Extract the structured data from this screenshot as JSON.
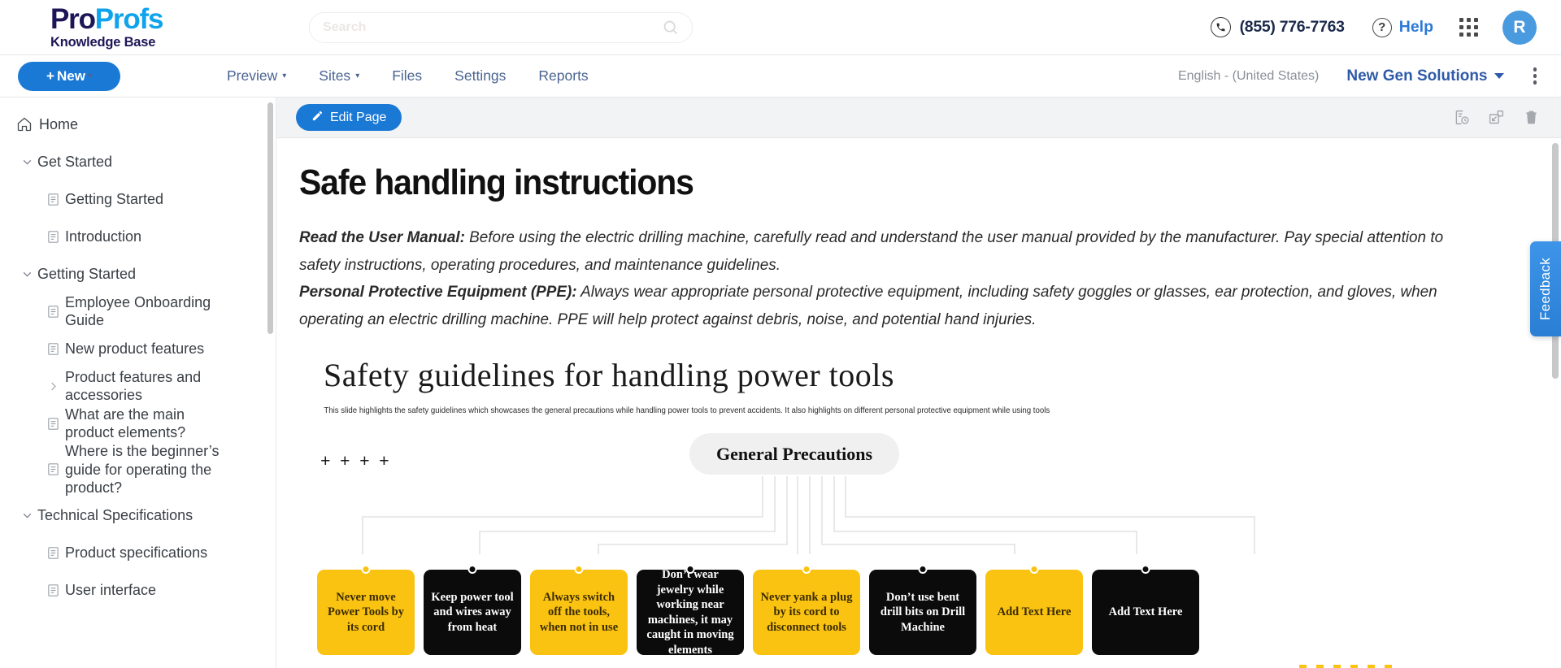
{
  "brand": {
    "name_part1": "Pro",
    "name_part2": "Profs",
    "subtitle": "Knowledge Base",
    "accent_blue": "#0fa3ec",
    "navy": "#1c1656"
  },
  "search": {
    "placeholder": "Search",
    "value": "",
    "icon": "search-icon"
  },
  "topbar": {
    "phone": "(855) 776-7763",
    "phone_icon": "phone-icon",
    "help_label": "Help",
    "help_icon": "question-mark-icon",
    "apps_icon": "grid-apps-icon",
    "avatar_initial": "R"
  },
  "navbar": {
    "new_label": "New",
    "new_plus": "+",
    "items": [
      {
        "label": "Preview",
        "has_caret": true
      },
      {
        "label": "Sites",
        "has_caret": true
      },
      {
        "label": "Files",
        "has_caret": false
      },
      {
        "label": "Settings",
        "has_caret": false
      },
      {
        "label": "Reports",
        "has_caret": false
      }
    ],
    "language": "English - (United States)",
    "organization": "New Gen Solutions",
    "kebab_icon": "more-vertical-icon"
  },
  "sidebar": {
    "items": [
      {
        "label": "Home",
        "type": "home",
        "icon": "home-icon"
      },
      {
        "label": "Get Started",
        "type": "group",
        "icon": "chevron-down-icon"
      },
      {
        "label": "Getting Started",
        "type": "page",
        "icon": "document-icon"
      },
      {
        "label": "Introduction",
        "type": "page",
        "icon": "document-icon"
      },
      {
        "label": "Getting Started",
        "type": "group",
        "icon": "chevron-down-icon"
      },
      {
        "label": "Employee Onboarding Guide",
        "type": "page",
        "icon": "document-icon"
      },
      {
        "label": "New product features",
        "type": "page",
        "icon": "document-icon"
      },
      {
        "label": "Product features and accessories",
        "type": "page-collapsed",
        "icon": "chevron-right-icon"
      },
      {
        "label": "What are the main product elements?",
        "type": "page",
        "icon": "document-icon"
      },
      {
        "label": "Where is the beginner’s guide for operating the product?",
        "type": "page",
        "icon": "document-icon"
      },
      {
        "label": "Technical Specifications",
        "type": "group",
        "icon": "chevron-down-icon"
      },
      {
        "label": "Product specifications",
        "type": "page",
        "icon": "document-icon"
      },
      {
        "label": "User interface",
        "type": "page",
        "icon": "document-icon"
      }
    ]
  },
  "toolbar": {
    "edit_label": "Edit Page",
    "edit_icon": "pencil-icon",
    "icons": [
      {
        "name": "revision-history-icon"
      },
      {
        "name": "popout-expand-icon"
      },
      {
        "name": "delete-trash-icon"
      }
    ]
  },
  "article": {
    "title": "Safe handling instructions",
    "paragraphs": [
      {
        "lead": "Read the User Manual:",
        "body": " Before using the electric drilling machine, carefully read and understand the user manual provided by the manufacturer. Pay special attention to safety instructions, operating procedures, and maintenance guidelines."
      },
      {
        "lead": "Personal Protective Equipment (PPE):",
        "body": " Always wear appropriate personal protective equipment, including safety goggles or glasses, ear protection, and gloves, when operating an electric drilling machine. PPE will help protect against debris, noise, and potential hand injuries."
      }
    ]
  },
  "slide": {
    "title": "Safety guidelines for handling power tools",
    "subtitle": "This slide highlights the safety guidelines which showcases the general precautions while handling power tools to prevent accidents. It also highlights on different personal protective equipment  while using tools",
    "plus_marks": "+ + + +",
    "hub_label": "General Precautions",
    "colors": {
      "yellow": "#fbc311",
      "black": "#0b0b0b",
      "pill_bg": "#f0f0f0"
    },
    "cards": [
      {
        "text": "Never move Power Tools by its cord",
        "style": "yellow"
      },
      {
        "text": "Keep power tool and wires away from  heat",
        "style": "black"
      },
      {
        "text": "Always switch off the tools, when not in use",
        "style": "yellow"
      },
      {
        "text": "Don’t wear jewelry while working  near machines, it may caught in moving elements",
        "style": "black"
      },
      {
        "text": "Never yank a plug by its cord to disconnect tools",
        "style": "yellow"
      },
      {
        "text": "Don’t use bent drill bits on Drill Machine",
        "style": "black"
      },
      {
        "text": "Add Text Here",
        "style": "yellow"
      },
      {
        "text": "Add Text Here",
        "style": "black"
      }
    ]
  },
  "feedback": {
    "label": "Feedback",
    "color": "#2a7fd4"
  }
}
